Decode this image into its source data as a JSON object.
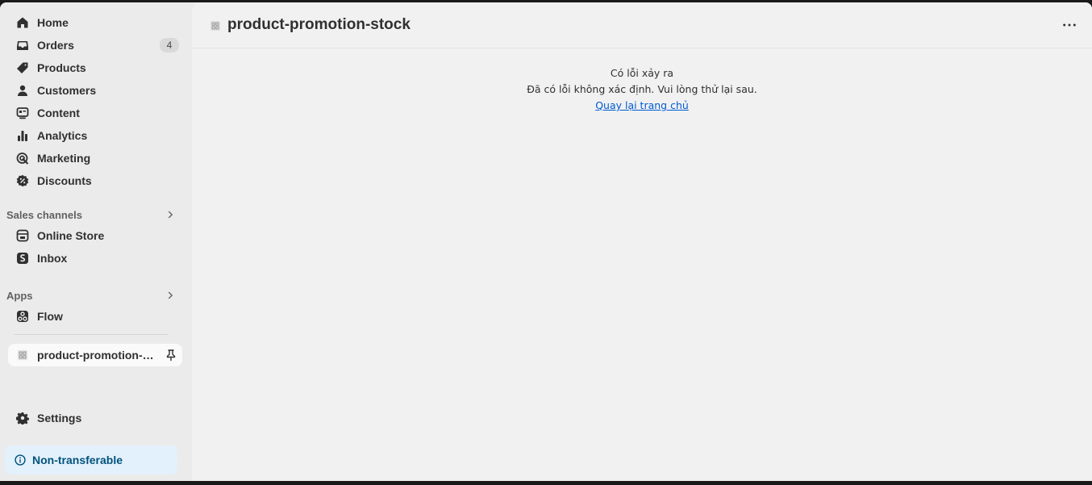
{
  "sidebar": {
    "items": [
      {
        "label": "Home",
        "icon": "home-icon"
      },
      {
        "label": "Orders",
        "icon": "inbox-icon",
        "badge": "4"
      },
      {
        "label": "Products",
        "icon": "tag-icon"
      },
      {
        "label": "Customers",
        "icon": "person-icon"
      },
      {
        "label": "Content",
        "icon": "content-icon"
      },
      {
        "label": "Analytics",
        "icon": "bar-chart-icon"
      },
      {
        "label": "Marketing",
        "icon": "target-icon"
      },
      {
        "label": "Discounts",
        "icon": "discount-icon"
      }
    ],
    "sales_channels": {
      "heading": "Sales channels",
      "items": [
        {
          "label": "Online Store",
          "icon": "store-icon"
        },
        {
          "label": "Inbox",
          "icon": "inbox-app-icon"
        }
      ]
    },
    "apps": {
      "heading": "Apps",
      "items": [
        {
          "label": "Flow",
          "icon": "flow-icon"
        }
      ]
    },
    "pinned": {
      "label": "product-promotion-stock",
      "icon": "app-icon"
    },
    "settings": {
      "label": "Settings",
      "icon": "gear-icon"
    },
    "plan_notice": {
      "label": "Non-transferable",
      "icon": "info-icon"
    }
  },
  "header": {
    "title": "product-promotion-stock"
  },
  "error": {
    "title": "Có lỗi xảy ra",
    "message": "Đã có lỗi không xác định. Vui lòng thử lại sau.",
    "link": "Quay lại trang chủ"
  },
  "colors": {
    "link": "#005bd3",
    "notice_bg": "#e3f1fd",
    "notice_text": "#00527c"
  }
}
